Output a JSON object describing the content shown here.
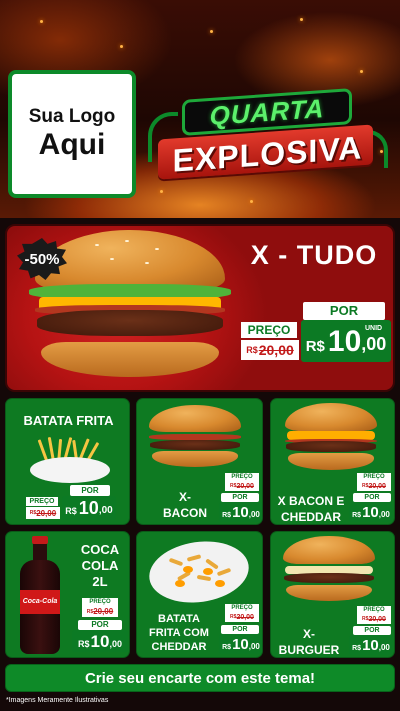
{
  "brand": {
    "logo_line1": "Sua Logo",
    "logo_line2": "Aqui"
  },
  "promo": {
    "tag": "QUARTA",
    "headline": "EXPLOSIVA"
  },
  "featured": {
    "discount": "-50%",
    "title": "X - TUDO",
    "preco_label": "PREÇO",
    "por_label": "POR",
    "old_currency": "R$",
    "old_price": "20,00",
    "new_currency": "R$",
    "new_price_int": "10",
    "new_price_dec": ",00",
    "unit": "UNID"
  },
  "products": [
    {
      "name": "BATATA FRITA",
      "preco_label": "PREÇO",
      "old_currency": "R$",
      "old_price": "20,00",
      "por_label": "POR",
      "new_currency": "R$",
      "new_price_int": "10",
      "new_price_dec": ",00",
      "unit": "UNID"
    },
    {
      "name": "X-\nBACON",
      "preco_label": "PREÇO",
      "old_currency": "R$",
      "old_price": "20,00",
      "por_label": "POR",
      "new_currency": "R$",
      "new_price_int": "10",
      "new_price_dec": ",00",
      "unit": "UNID"
    },
    {
      "name": "X BACON E\nCHEDDAR",
      "preco_label": "PREÇO",
      "old_currency": "R$",
      "old_price": "20,00",
      "por_label": "POR",
      "new_currency": "R$",
      "new_price_int": "10",
      "new_price_dec": ",00",
      "unit": "UNID"
    },
    {
      "name": "COCA\nCOLA\n2L",
      "preco_label": "PREÇO",
      "old_currency": "R$",
      "old_price": "20,00",
      "por_label": "POR",
      "new_currency": "R$",
      "new_price_int": "10",
      "new_price_dec": ",00",
      "unit": "UNID"
    },
    {
      "name": "BATATA\nFRITA COM\nCHEDDAR",
      "preco_label": "PREÇO",
      "old_currency": "R$",
      "old_price": "20,00",
      "por_label": "POR",
      "new_currency": "R$",
      "new_price_int": "10",
      "new_price_dec": ",00",
      "unit": "UNID"
    },
    {
      "name": "X-\nBURGUER",
      "preco_label": "PREÇO",
      "old_currency": "R$",
      "old_price": "20,00",
      "por_label": "POR",
      "new_currency": "R$",
      "new_price_int": "10",
      "new_price_dec": ",00",
      "unit": "UNID"
    }
  ],
  "cta": {
    "label": "Crie seu encarte com este tema!"
  },
  "disclaimer": "*Imagens Meramente Ilustrativas",
  "colors": {
    "green": "#0e7a22",
    "red": "#b51313",
    "price_red": "#c21a1a",
    "bun": "#d8892e"
  },
  "icons": [
    "burger-image",
    "fries-image",
    "soda-bottle-image",
    "cheddar-fries-image",
    "bacon-burger-image",
    "cheddar-burger-image",
    "cheeseburger-image"
  ]
}
